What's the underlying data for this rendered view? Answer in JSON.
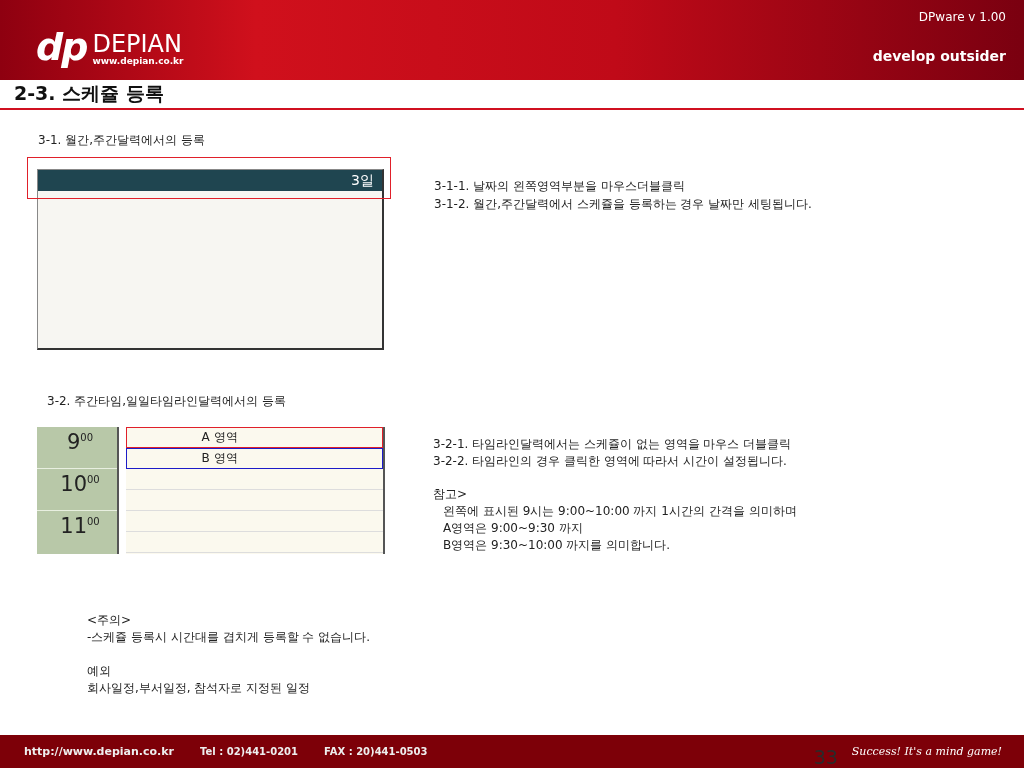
{
  "header": {
    "logo_mark": "dp",
    "logo_name": "DEPIAN",
    "logo_url": "www.depian.co.kr",
    "version": "DPware v 1.00",
    "tagline": "develop outsider"
  },
  "title": "2-3. 스케쥴 등록",
  "month_section": {
    "heading": "3-1. 월간,주간달력에서의 등록",
    "day": "3일",
    "notes": [
      "3-1-1. 날짜의 왼쪽영역부분을 마우스더블클릭",
      "3-1-2. 월간,주간달력에서 스케쥴을 등록하는 경우 날짜만 세팅됩니다."
    ]
  },
  "timeline_section": {
    "heading": "3-2. 주간타임,일일타임라인달력에서의 등록",
    "hours": [
      {
        "hour": "9",
        "minutes": "00"
      },
      {
        "hour": "10",
        "minutes": "00"
      },
      {
        "hour": "11",
        "minutes": "00"
      }
    ],
    "regions": [
      {
        "label": "A 영역",
        "color": "#e0202a"
      },
      {
        "label": "B 영역",
        "color": "#1c1cc8"
      }
    ],
    "notes": [
      "3-2-1. 타임라인달력에서는 스케쥴이 없는 영역을 마우스 더블클릭",
      "3-2-2. 타임라인의 경우 클릭한 영역에 따라서 시간이 설정됩니다."
    ],
    "reference": {
      "heading": "참고>",
      "lines": [
        "왼쪽에 표시된 9시는 9:00~10:00 까지 1시간의 간격을 의미하며",
        "A영역은 9:00~9:30 까지",
        "B영역은 9:30~10:00 까지를 의미합니다."
      ]
    }
  },
  "caution": {
    "heading": "<주의>",
    "line": "-스케쥴 등록시 시간대를 겹치게 등록할 수 없습니다.",
    "exception_heading": "예외",
    "exception_line": "회사일정,부서일정, 참석자로 지정된 일정"
  },
  "footer": {
    "url": "http://www.depian.co.kr",
    "tel": "Tel : 02)441-0201",
    "fax": "FAX : 20)441-0503",
    "page": "33",
    "slogan": "Success! It's a mind game!"
  }
}
